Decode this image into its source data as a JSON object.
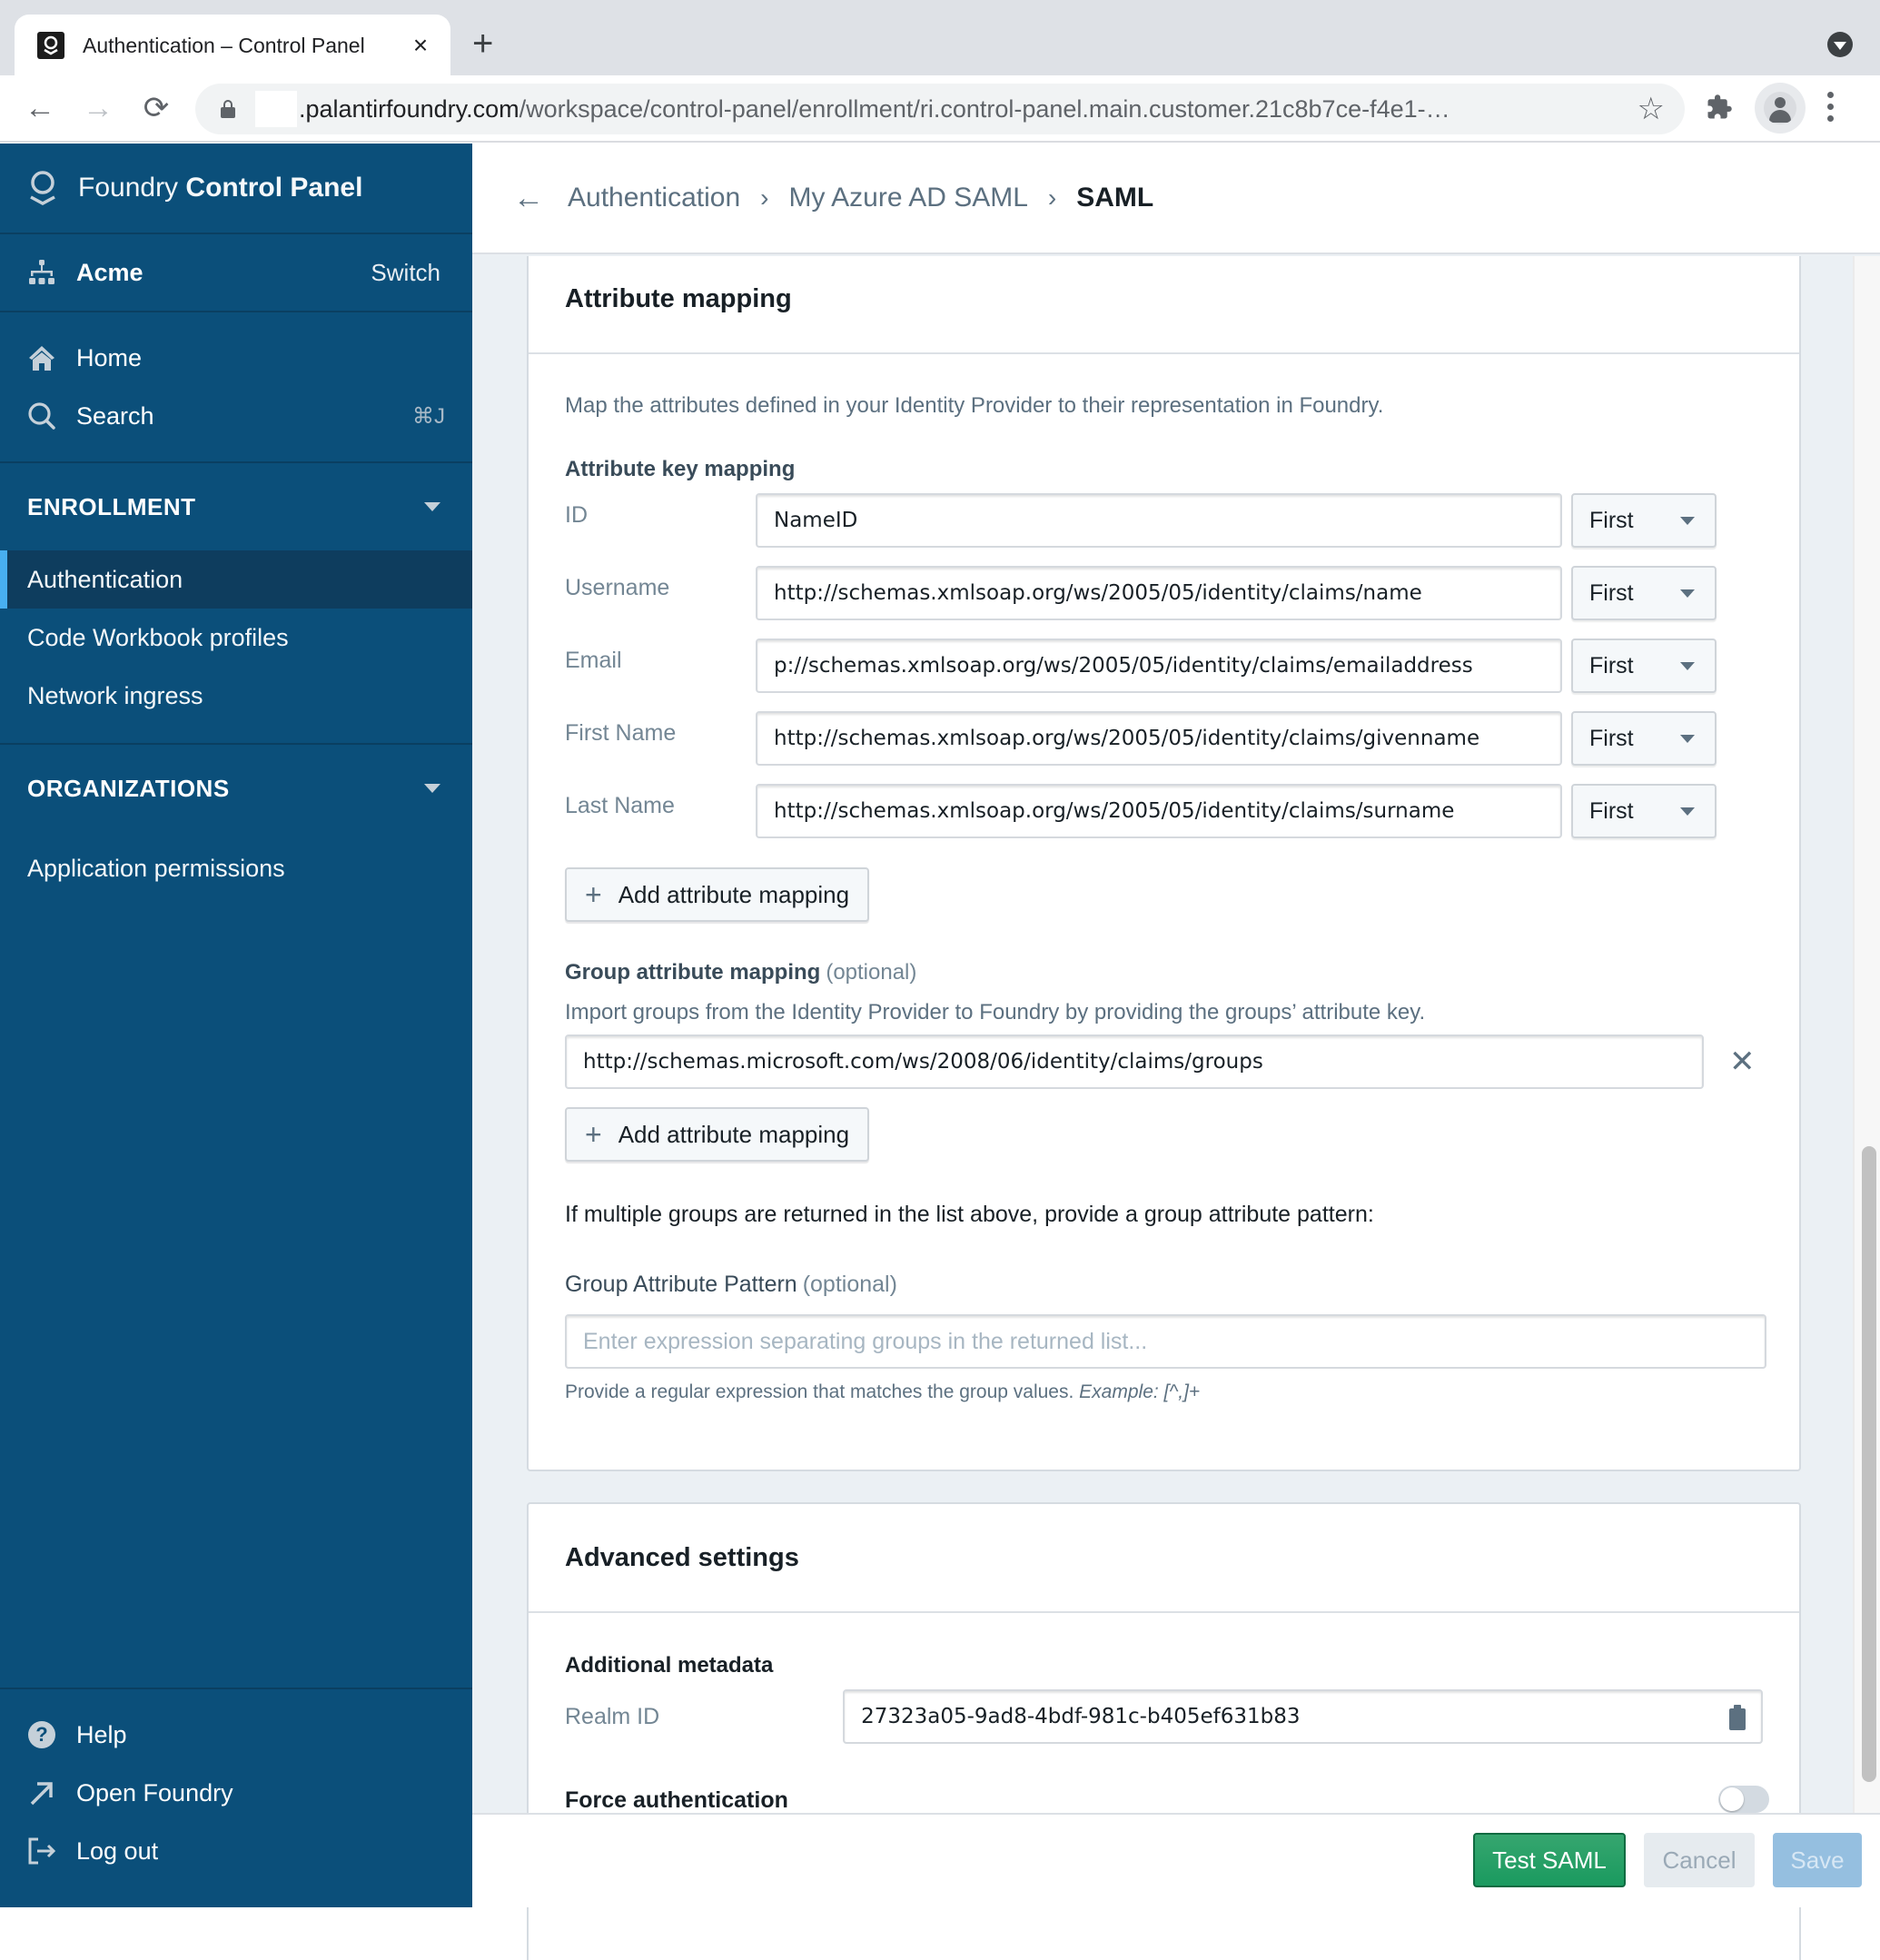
{
  "browser": {
    "tab_title": "Authentication – Control Panel",
    "tab_close": "×",
    "new_tab": "+",
    "url_domain": ".palantirfoundry.com",
    "url_path": "/workspace/control-panel/enrollment/ri.control-panel.main.customer.21c8b7ce-f4e1-…",
    "back": "←",
    "forward": "→",
    "reload": "⟳",
    "star": "☆",
    "extensions": "✱"
  },
  "sidebar": {
    "brand_light": "Foundry",
    "brand_bold": "Control Panel",
    "org_name": "Acme",
    "org_switch": "Switch",
    "nav": [
      {
        "label": "Home",
        "icon": "home-icon"
      },
      {
        "label": "Search",
        "icon": "search-icon",
        "shortcut": "⌘J"
      }
    ],
    "sections": [
      {
        "title": "ENROLLMENT",
        "items": [
          {
            "label": "Authentication",
            "active": true
          },
          {
            "label": "Code Workbook profiles",
            "active": false
          },
          {
            "label": "Network ingress",
            "active": false
          }
        ]
      },
      {
        "title": "ORGANIZATIONS",
        "items": [
          {
            "label": "Application permissions",
            "active": false
          }
        ]
      }
    ],
    "bottom": [
      {
        "label": "Help",
        "icon": "help-icon"
      },
      {
        "label": "Open Foundry",
        "icon": "external-link-icon"
      },
      {
        "label": "Log out",
        "icon": "logout-icon"
      }
    ]
  },
  "header": {
    "back": "←",
    "breadcrumbs": [
      "Authentication",
      "My Azure AD SAML",
      "SAML"
    ],
    "separator": "›"
  },
  "attribute_mapping": {
    "title": "Attribute mapping",
    "description": "Map the attributes defined in your Identity Provider to their representation in Foundry.",
    "key_mapping_heading": "Attribute key mapping",
    "rows": [
      {
        "label": "ID",
        "value": "NameID",
        "select": "First"
      },
      {
        "label": "Username",
        "value": "http://schemas.xmlsoap.org/ws/2005/05/identity/claims/name",
        "select": "First"
      },
      {
        "label": "Email",
        "value": "p://schemas.xmlsoap.org/ws/2005/05/identity/claims/emailaddress",
        "select": "First"
      },
      {
        "label": "First Name",
        "value": "http://schemas.xmlsoap.org/ws/2005/05/identity/claims/givenname",
        "select": "First"
      },
      {
        "label": "Last Name",
        "value": "http://schemas.xmlsoap.org/ws/2005/05/identity/claims/surname",
        "select": "First"
      }
    ],
    "add_button": "Add attribute mapping",
    "group_heading": "Group attribute mapping",
    "optional": "(optional)",
    "group_description": "Import groups from the Identity Provider to Foundry by providing the groups’ attribute key.",
    "group_value": "http://schemas.microsoft.com/ws/2008/06/identity/claims/groups",
    "group_add_button": "Add attribute mapping",
    "multiple_groups_text": "If multiple groups are returned in the list above, provide a group attribute pattern:",
    "pattern_label": "Group Attribute Pattern",
    "pattern_placeholder": "Enter expression separating groups in the returned list...",
    "pattern_helper": "Provide a regular expression that matches the group values.",
    "pattern_example": "Example: [^,]+"
  },
  "advanced_settings": {
    "title": "Advanced settings",
    "metadata_heading": "Additional metadata",
    "realm_label": "Realm ID",
    "realm_value": "27323a05-9ad8-4bdf-981c-b405ef631b83",
    "force_auth_label": "Force authentication",
    "force_auth_enabled": false
  },
  "footer": {
    "test": "Test SAML",
    "cancel": "Cancel",
    "save": "Save"
  },
  "colors": {
    "sidebar_bg": "#0b4f7a",
    "active_indicator": "#48aff0",
    "primary_green": "#1a9a5f",
    "save_disabled": "#95bfe0"
  }
}
